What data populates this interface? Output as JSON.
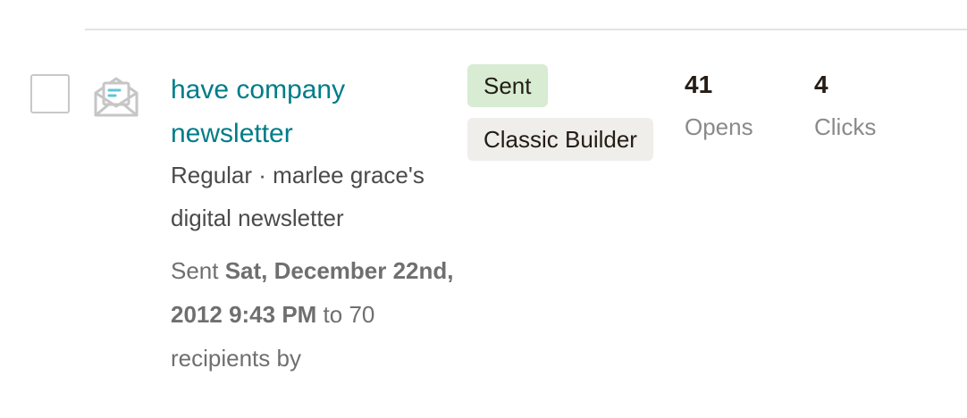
{
  "campaign": {
    "title": "have company newsletter",
    "type_audience": "Regular · marlee grace's digital newsletter",
    "sent_prefix": "Sent ",
    "sent_date": "Sat, December 22nd, 2012 9:43 PM",
    "sent_suffix": " to 70 recipients by",
    "status_badge": "Sent",
    "builder_badge": "Classic Builder"
  },
  "stats": {
    "opens_value": "41",
    "opens_label": "Opens",
    "clicks_value": "4",
    "clicks_label": "Clicks"
  },
  "icons": {
    "row_icon": "envelope-open-icon"
  },
  "colors": {
    "link": "#007c89",
    "sent_badge_bg": "#d7ecd2",
    "builder_badge_bg": "#efeeea",
    "icon_accent": "#5fc4d8"
  }
}
